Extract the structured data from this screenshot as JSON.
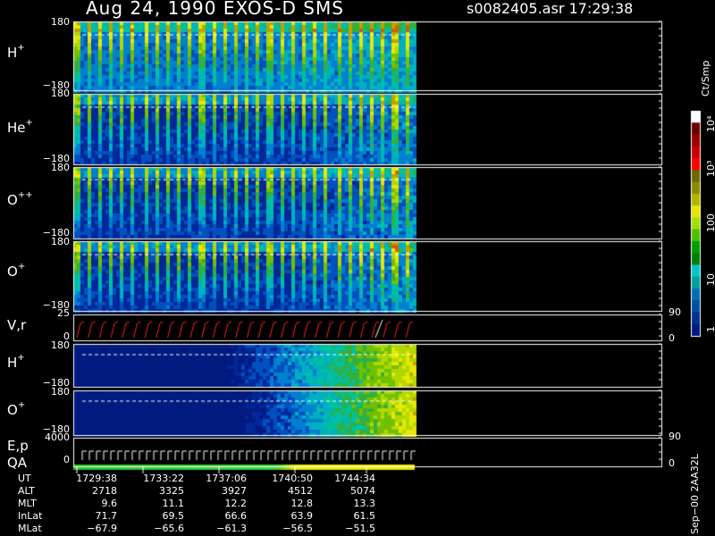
{
  "header": {
    "title": "Aug 24, 1990    EXOS-D SMS",
    "file": "s0082405.asr  17:29:38"
  },
  "panels": [
    {
      "label": "H",
      "charge": "+",
      "ymax": "180",
      "ymin": "−180"
    },
    {
      "label": "He",
      "charge": "+",
      "ymax": "180",
      "ymin": "−180"
    },
    {
      "label": "O",
      "charge": "++",
      "ymax": "180",
      "ymin": "−180"
    },
    {
      "label": "O",
      "charge": "+",
      "ymax": "180",
      "ymin": "−180"
    },
    {
      "label": "V,r",
      "charge": "",
      "ymax": "25",
      "ymin": "0",
      "rmax": "90",
      "rmin": "0"
    },
    {
      "label": "H",
      "charge": "+",
      "ymax": "180",
      "ymin": "−180"
    },
    {
      "label": "O",
      "charge": "+",
      "ymax": "180",
      "ymin": "−180",
      "rmax": "90"
    },
    {
      "label": "E,p",
      "label2": "QA",
      "charge": "",
      "ymax": "4000",
      "ymin": "0",
      "rmin": "0"
    }
  ],
  "colorbar": {
    "unit": "Ct/Smp",
    "labels": [
      "10⁴",
      "10³",
      "100",
      "10",
      "1"
    ],
    "colors": [
      "#ffffff",
      "#6b0000",
      "#9b0000",
      "#c80000",
      "#ff0000",
      "#6b6b00",
      "#8b8b00",
      "#b5b500",
      "#e6e600",
      "#a0e000",
      "#50c000",
      "#00a000",
      "#008000",
      "#00c8c8",
      "#00a0a0",
      "#0070b0",
      "#0050a0",
      "#003090",
      "#001a80"
    ]
  },
  "footer_note": "Sep−00  2AA32L",
  "ephemeris": {
    "rows": [
      {
        "name": "UT",
        "values": [
          "1729:38",
          "1733:22",
          "1737:06",
          "1740:50",
          "1744:34"
        ]
      },
      {
        "name": "ALT",
        "values": [
          "2718",
          "3325",
          "3927",
          "4512",
          "5074"
        ]
      },
      {
        "name": "MLT",
        "values": [
          "9.6",
          "11.1",
          "12.2",
          "12.8",
          "13.3"
        ]
      },
      {
        "name": "InLat",
        "values": [
          "71.7",
          "69.5",
          "66.6",
          "63.9",
          "61.5"
        ]
      },
      {
        "name": "MLat",
        "values": [
          "−67.9",
          "−65.6",
          "−61.3",
          "−56.5",
          "−51.5"
        ]
      }
    ]
  },
  "chart_data": {
    "type": "heatmap",
    "title": "Aug 24, 1990    EXOS-D SMS",
    "x_ticks_ut": [
      "1729:38",
      "1733:22",
      "1737:06",
      "1740:50",
      "1744:34"
    ],
    "y_range_pitch": [
      -180,
      180
    ],
    "color_scale": "log",
    "color_range": [
      1,
      10000
    ],
    "series": [
      {
        "name": "H+",
        "intensity_trend": "high"
      },
      {
        "name": "He+",
        "intensity_trend": "medium"
      },
      {
        "name": "O++",
        "intensity_trend": "medium"
      },
      {
        "name": "O+",
        "intensity_trend": "medium"
      },
      {
        "name": "H+",
        "intensity_trend": "low-rising"
      },
      {
        "name": "O+",
        "intensity_trend": "low-rising"
      }
    ]
  }
}
